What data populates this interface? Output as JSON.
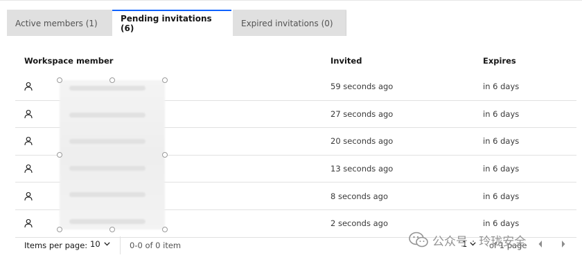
{
  "tabs": [
    {
      "label": "Active members (1)"
    },
    {
      "label": "Pending invitations (6)"
    },
    {
      "label": "Expired invitations (0)"
    }
  ],
  "table": {
    "headers": {
      "member": "Workspace member",
      "invited": "Invited",
      "expires": "Expires"
    },
    "rows": [
      {
        "invited": "59 seconds ago",
        "expires": "in 6 days"
      },
      {
        "invited": "27 seconds ago",
        "expires": "in 6 days"
      },
      {
        "invited": "20 seconds ago",
        "expires": "in 6 days"
      },
      {
        "invited": "13 seconds ago",
        "expires": "in 6 days"
      },
      {
        "invited": "8 seconds ago",
        "expires": "in 6 days"
      },
      {
        "invited": "2 seconds ago",
        "expires": "in 6 days"
      }
    ]
  },
  "footer": {
    "items_per_page_label": "Items per page:",
    "items_per_page_value": "10",
    "range_text": "0-0 of 0 item",
    "current_page": "1",
    "of_pages": "of 1 page"
  },
  "watermark": {
    "text": "公众号 · 玲珑安全"
  },
  "colors": {
    "accent": "#0f62fe",
    "tab_inactive": "#e0e0e0",
    "row_border": "#e0e0e0"
  }
}
